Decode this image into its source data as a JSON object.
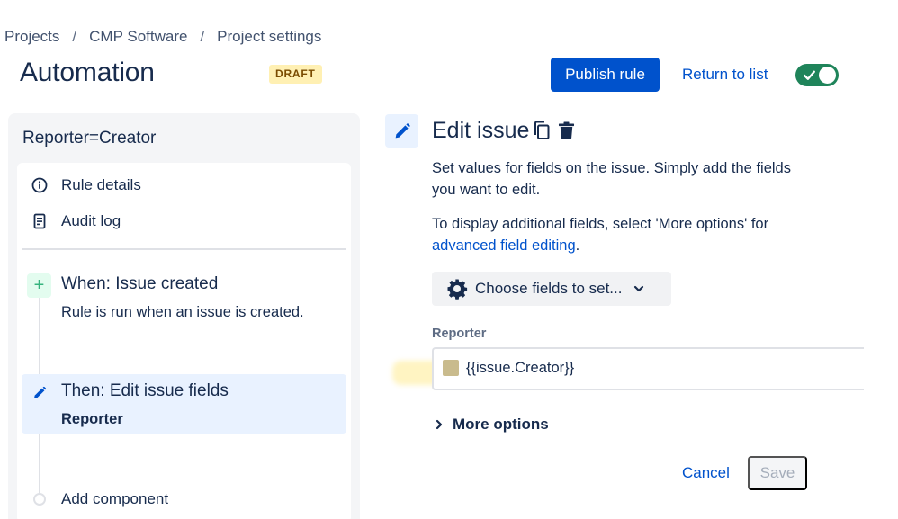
{
  "breadcrumb": {
    "items": [
      "Projects",
      "CMP Software",
      "Project settings"
    ],
    "separator": "/"
  },
  "header": {
    "title": "Automation",
    "badge": "DRAFT",
    "publish_label": "Publish rule",
    "return_label": "Return to list",
    "toggle_enabled": true
  },
  "rule": {
    "name": "Reporter=Creator",
    "nav": [
      {
        "label": "Rule details",
        "icon": "info-icon"
      },
      {
        "label": "Audit log",
        "icon": "document-icon"
      }
    ],
    "trigger": {
      "title": "When: Issue created",
      "description": "Rule is run when an issue is created.",
      "icon": "plus-icon"
    },
    "action": {
      "title": "Then: Edit issue fields",
      "subtitle": "Reporter",
      "icon": "pencil-icon"
    },
    "add_component_label": "Add component"
  },
  "editor": {
    "title": "Edit issue",
    "description": "Set values for fields on the issue. Simply add the fields you want to edit.",
    "more_info_prefix": "To display additional fields, select 'More options' for ",
    "more_info_link": "advanced field editing",
    "more_info_suffix": ".",
    "choose_fields_label": "Choose fields to set...",
    "field_label": "Reporter",
    "field_value": "{{issue.Creator}}",
    "more_options_label": "More options",
    "cancel_label": "Cancel",
    "save_label": "Save"
  },
  "colors": {
    "primary": "#0052cc",
    "toggle_on": "#1f845a",
    "draft_bg": "#fff0b3",
    "action_bg": "#e9f2ff",
    "panel_bg": "#f4f5f7"
  }
}
